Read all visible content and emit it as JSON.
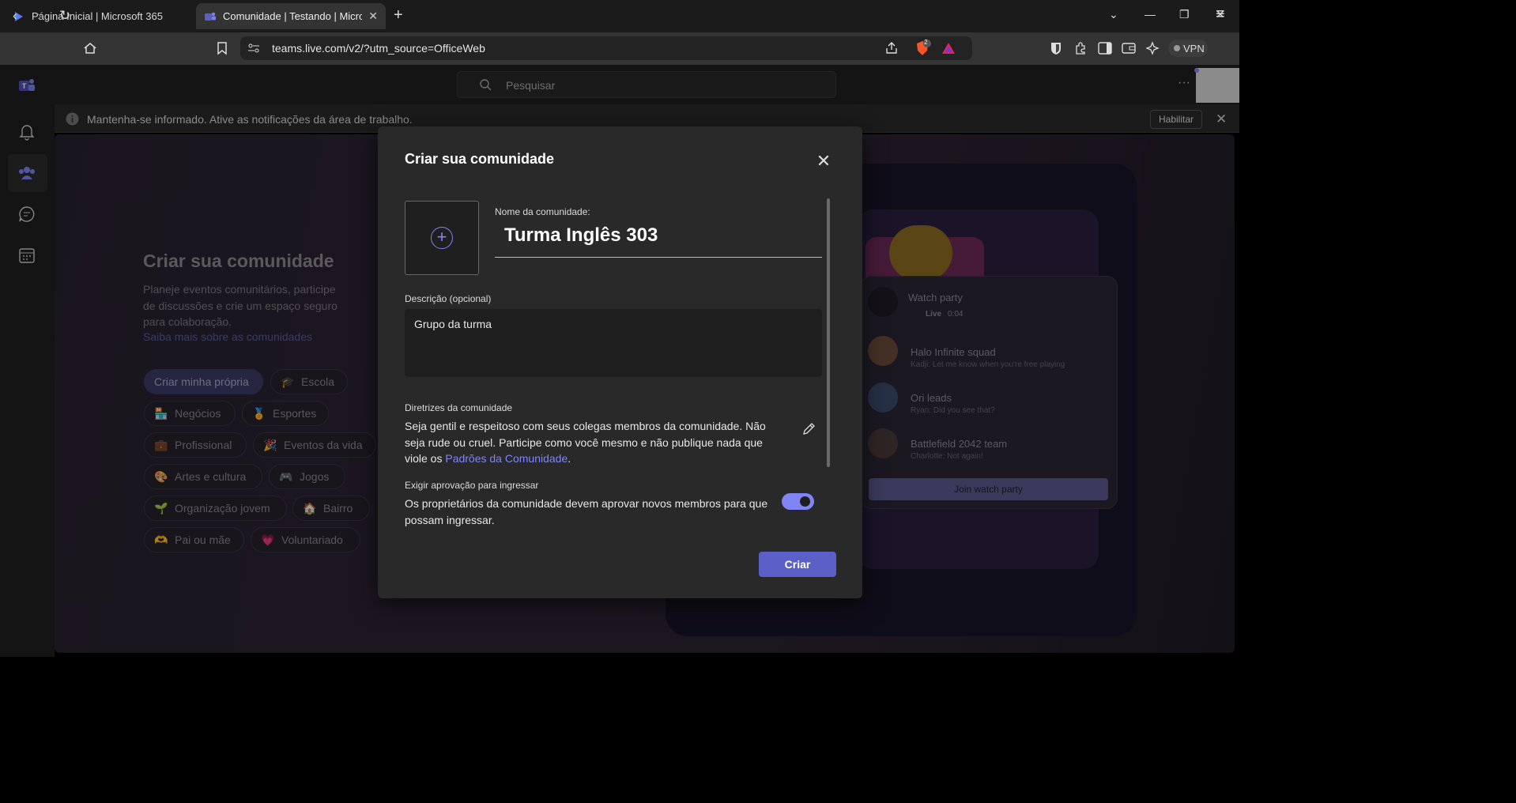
{
  "browser": {
    "tabs": [
      {
        "label": "Página Inicial | Microsoft 365",
        "icon": "microsoft-365-icon"
      },
      {
        "label": "Comunidade | Testando | Microsoft Teams",
        "icon": "teams-icon"
      }
    ],
    "url": "teams.live.com/v2/?utm_source=OfficeWeb",
    "vpn_label": "VPN",
    "brave_badge": "2"
  },
  "teams": {
    "search_placeholder": "Pesquisar",
    "notification": {
      "text": "Mantenha-se informado. Ative as notificações da área de trabalho.",
      "enable_label": "Habilitar"
    },
    "rail_icons": [
      "teams-logo-icon",
      "bell-icon",
      "communities-icon",
      "chat-icon",
      "calendar-icon"
    ]
  },
  "background": {
    "heading": "Criar sua comunidade",
    "description": "Planeje eventos comunitários, participe de discussões e crie um espaço seguro para colaboração.",
    "learn_more": "Saiba mais sobre as comunidades",
    "chips": [
      {
        "label": "Criar minha própria",
        "emoji": ""
      },
      {
        "label": "Escola",
        "emoji": "🎓"
      },
      {
        "label": "Negócios",
        "emoji": "🏪"
      },
      {
        "label": "Esportes",
        "emoji": "🏅"
      },
      {
        "label": "Profissional",
        "emoji": "💼"
      },
      {
        "label": "Eventos da vida",
        "emoji": "🎉"
      },
      {
        "label": "Artes e cultura",
        "emoji": "🎨"
      },
      {
        "label": "Jogos",
        "emoji": "🎮"
      },
      {
        "label": "Organização jovem",
        "emoji": "🌱"
      },
      {
        "label": "Bairro",
        "emoji": "🏠"
      },
      {
        "label": "Pai ou mãe",
        "emoji": "🫶"
      },
      {
        "label": "Voluntariado",
        "emoji": "💗"
      }
    ],
    "watch_party": {
      "title": "Watch party",
      "live": "Live",
      "time": "0:04",
      "items": [
        {
          "name": "Halo Infinite squad",
          "message": "Kadji: Let me know when you're free playing"
        },
        {
          "name": "Ori leads",
          "message": "Ryan: Did you see that?"
        },
        {
          "name": "Battlefield 2042 team",
          "message": "Charlotte: Not again!"
        }
      ],
      "join_label": "Join watch party"
    }
  },
  "dialog": {
    "title": "Criar sua comunidade",
    "name_label": "Nome da comunidade:",
    "name_value": "Turma Inglês 303",
    "description_label": "Descrição (opcional)",
    "description_value": "Grupo da turma",
    "guidelines_label": "Diretrizes da comunidade",
    "guidelines_text": "Seja gentil e respeitoso com seus colegas membros da comunidade. Não seja rude ou cruel. Participe como você mesmo e não publique nada que viole os ",
    "guidelines_link": "Padrões da Comunidade",
    "guidelines_end": ".",
    "approval_label": "Exigir aprovação para ingressar",
    "approval_text": "Os proprietários da comunidade devem aprovar novos membros para que possam ingressar.",
    "approval_enabled": true,
    "create_label": "Criar"
  }
}
